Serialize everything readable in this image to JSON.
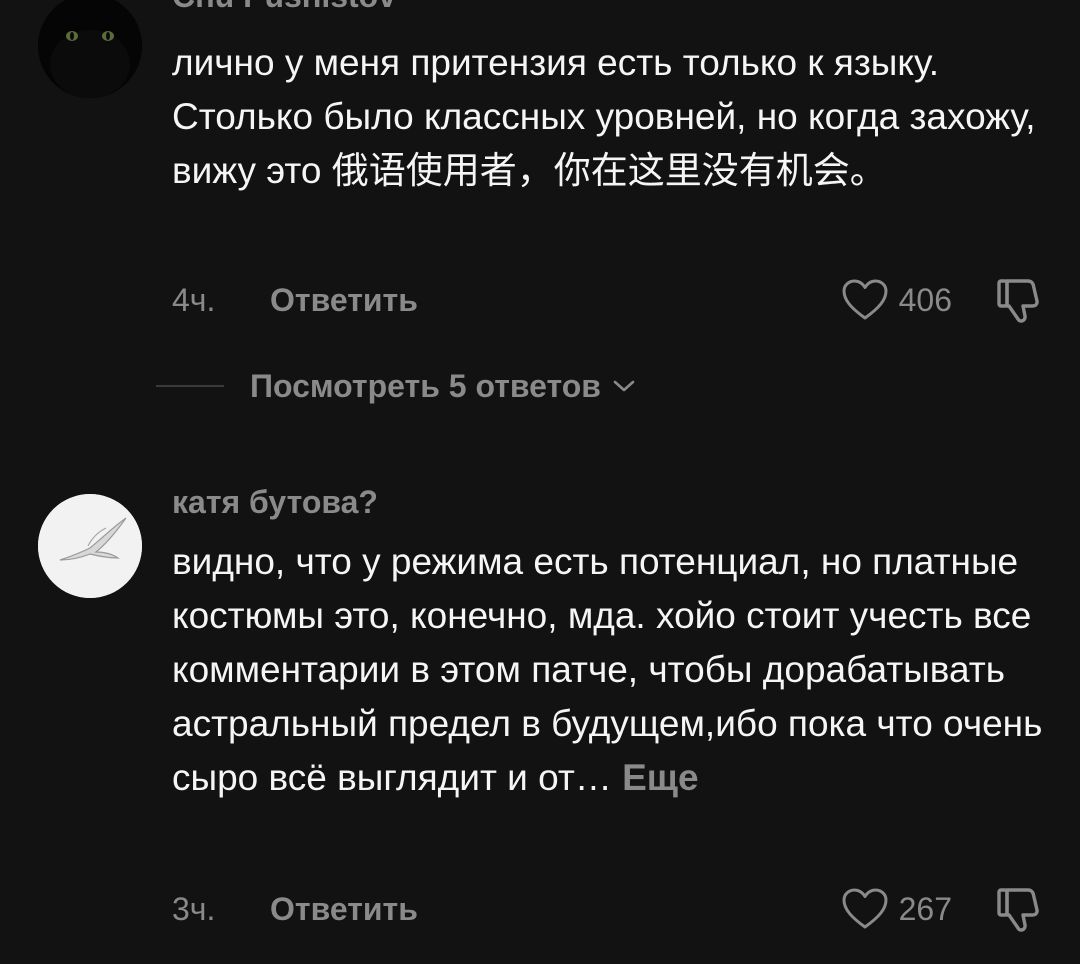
{
  "comments": [
    {
      "username": "Chu Pushistov",
      "avatar_icon": "black-cat-avatar-icon",
      "text": "лично у меня притензия есть только к языку. Столько было классных уровней, но когда захожу, вижу это 俄语使用者，你在这里没有机会。",
      "more_label": "",
      "timestamp": "4ч.",
      "reply_label": "Ответить",
      "like_count": "406",
      "replies_label": "Посмотреть 5 ответов"
    },
    {
      "username": "катя бутова?",
      "avatar_icon": "seagull-avatar-icon",
      "text": "видно, что у режима есть потенциал, но платные костюмы это, конечно, мда. хойо стоит учесть все комментарии в этом патче, чтобы дорабатывать астральный предел в будущем,ибо пока что очень сыро всё выглядит и от…",
      "more_label": "Еще",
      "timestamp": "3ч.",
      "reply_label": "Ответить",
      "like_count": "267"
    }
  ],
  "icons": {
    "like": "heart-icon",
    "dislike": "thumbs-down-icon",
    "expand": "chevron-down-icon"
  },
  "colors": {
    "background": "#121212",
    "text_primary": "#f5f5f5",
    "text_secondary": "#8a8a8a"
  }
}
